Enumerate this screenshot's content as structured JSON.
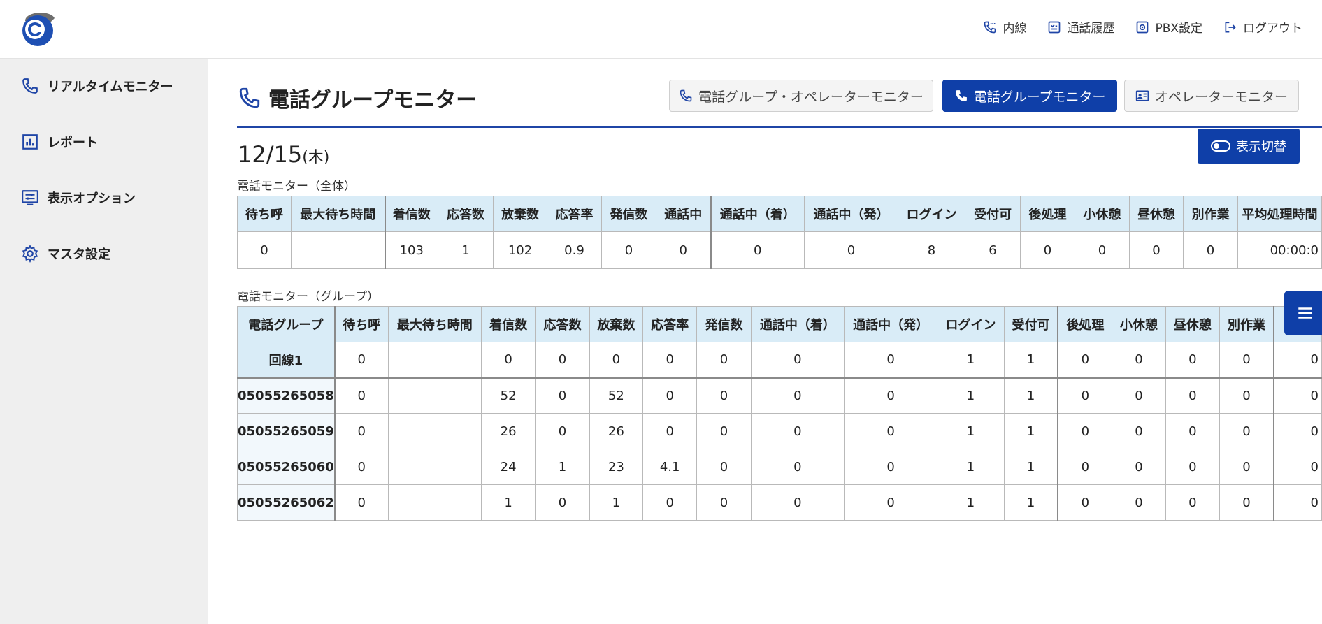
{
  "header": {
    "nav": [
      {
        "label": "内線",
        "icon": "phone-lines-icon"
      },
      {
        "label": "通話履歴",
        "icon": "call-history-icon"
      },
      {
        "label": "PBX設定",
        "icon": "gear-box-icon"
      },
      {
        "label": "ログアウト",
        "icon": "logout-icon"
      }
    ]
  },
  "sidebar": {
    "items": [
      {
        "label": "リアルタイムモニター",
        "icon": "phone-icon"
      },
      {
        "label": "レポート",
        "icon": "bar-chart-icon"
      },
      {
        "label": "表示オプション",
        "icon": "display-options-icon"
      },
      {
        "label": "マスタ設定",
        "icon": "gear-icon"
      }
    ]
  },
  "main": {
    "title": "電話グループモニター",
    "view_buttons": [
      {
        "label": "電話グループ・オペレーターモニター",
        "active": false
      },
      {
        "label": "電話グループモニター",
        "active": true
      },
      {
        "label": "オペレーターモニター",
        "active": false
      }
    ],
    "toggle_label": "表示切替",
    "date": "12/15",
    "dow": "(木)",
    "overall_label": "電話モニター（全体）",
    "group_label": "電話モニター（グループ）"
  },
  "overall_table": {
    "headers": [
      "待ち呼",
      "最大待ち時間",
      "着信数",
      "応答数",
      "放棄数",
      "応答率",
      "発信数",
      "通話中",
      "通話中（着）",
      "通話中（発）",
      "ログイン",
      "受付可",
      "後処理",
      "小休憩",
      "昼休憩",
      "別作業",
      "平均処理時間"
    ],
    "row": [
      "0",
      "",
      "103",
      "1",
      "102",
      "0.9",
      "0",
      "0",
      "0",
      "0",
      "8",
      "6",
      "0",
      "0",
      "0",
      "0",
      "00:00:0"
    ]
  },
  "group_table": {
    "headers": [
      "電話グループ",
      "待ち呼",
      "最大待ち時間",
      "着信数",
      "応答数",
      "放棄数",
      "応答率",
      "発信数",
      "通話中（着）",
      "通話中（発）",
      "ログイン",
      "受付可",
      "後処理",
      "小休憩",
      "昼休憩",
      "別作業",
      ""
    ],
    "rows": [
      [
        "回線1",
        "0",
        "",
        "0",
        "0",
        "0",
        "0",
        "0",
        "0",
        "0",
        "1",
        "1",
        "0",
        "0",
        "0",
        "0",
        "0"
      ],
      [
        "05055265058",
        "0",
        "",
        "52",
        "0",
        "52",
        "0",
        "0",
        "0",
        "0",
        "1",
        "1",
        "0",
        "0",
        "0",
        "0",
        "0"
      ],
      [
        "05055265059",
        "0",
        "",
        "26",
        "0",
        "26",
        "0",
        "0",
        "0",
        "0",
        "1",
        "1",
        "0",
        "0",
        "0",
        "0",
        "0"
      ],
      [
        "05055265060",
        "0",
        "",
        "24",
        "1",
        "23",
        "4.1",
        "0",
        "0",
        "0",
        "1",
        "1",
        "0",
        "0",
        "0",
        "0",
        "0"
      ],
      [
        "05055265062",
        "0",
        "",
        "1",
        "0",
        "1",
        "0",
        "0",
        "0",
        "0",
        "1",
        "1",
        "0",
        "0",
        "0",
        "0",
        "0"
      ]
    ]
  }
}
